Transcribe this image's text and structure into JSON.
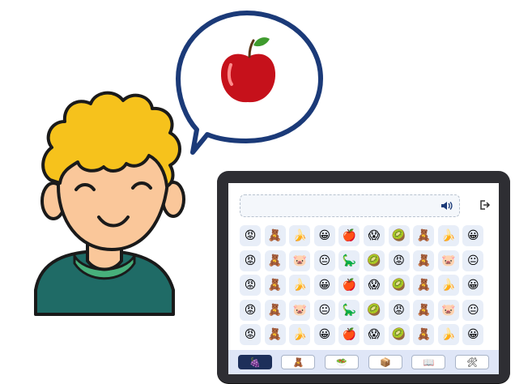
{
  "colors": {
    "bubble_outline": "#1b3a78",
    "hair": "#f6c21c",
    "skin": "#fac79a",
    "shirt": "#1f6b66",
    "collar": "#47b07b",
    "tablet_frame": "#2e2e33",
    "tile_bg": "#e8eef8",
    "tabbar_bg": "#dfe6f7",
    "active_tab": "#1d2f5a"
  },
  "thought_bubble": {
    "icon": "apple-icon"
  },
  "tablet": {
    "message_field": {
      "value": ""
    },
    "speaker_icon": "speaker-icon",
    "logout_icon": "logout-icon",
    "grid": [
      [
        "😡",
        "🧸",
        "🍌",
        "😀",
        "🍎",
        "😱",
        "🥝",
        "🧸",
        "🍌",
        "😀"
      ],
      [
        "😡",
        "🧸",
        "🐷",
        "😐",
        "🦕",
        "🥝",
        "😡",
        "🧸",
        "🐷",
        "😐"
      ],
      [
        "😡",
        "🧸",
        "🍌",
        "😀",
        "🍎",
        "😱",
        "🥝",
        "🧸",
        "🍌",
        "😀"
      ],
      [
        "😡",
        "🧸",
        "🐷",
        "😐",
        "🦕",
        "🥝",
        "😡",
        "🧸",
        "🐷",
        "😐"
      ],
      [
        "😡",
        "🧸",
        "🍌",
        "😀",
        "🍎",
        "😱",
        "🥝",
        "🧸",
        "🍌",
        "😀"
      ]
    ],
    "tabs": [
      {
        "icon": "🍇",
        "name": "tab-fruits",
        "active": true
      },
      {
        "icon": "🧸",
        "name": "tab-toys",
        "active": false
      },
      {
        "icon": "🥗",
        "name": "tab-food",
        "active": false
      },
      {
        "icon": "📦",
        "name": "tab-objects",
        "active": false
      },
      {
        "icon": "📖",
        "name": "tab-books",
        "active": false
      },
      {
        "icon": "🛠",
        "name": "tab-tools",
        "active": false
      }
    ]
  }
}
